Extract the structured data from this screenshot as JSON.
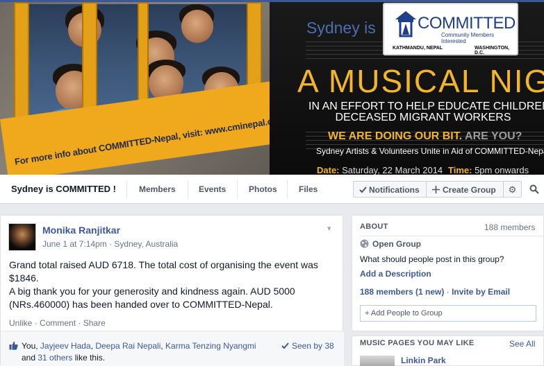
{
  "cover": {
    "banner_text": "For more info about COMMITTED-Nepal, visit: www.cminepal.org",
    "sydney_is": "Sydney is",
    "logo_word": "COMMITTED",
    "logo_sub": "Community Members Interested",
    "logo_place_left": "KATHMANDU, NEPAL",
    "logo_place_right": "WASHINGTON, D.C.",
    "headline": "A MUSICAL NIGHT",
    "subline1": "IN AN EFFORT TO HELP EDUCATE CHILDREN OF",
    "subline2": "DECEASED MIGRANT WORKERS",
    "doing_a": "WE ARE DOING OUR BIT.",
    "doing_b": "ARE YOU?",
    "artists": "Sydney Artists & Volunteers Unite in Aid of COMMITTED-Nepal",
    "date_label": "Date:",
    "date_value": "Saturday, 22 March 2014",
    "time_label": "Time:",
    "time_value": "5pm onwards"
  },
  "nav": {
    "group_name": "Sydney is COMMITTED !",
    "tabs": [
      "Members",
      "Events",
      "Photos",
      "Files"
    ],
    "notifications": "Notifications",
    "create_group": "Create Group"
  },
  "post": {
    "author": "Monika Ranjitkar",
    "meta": "June 1 at 7:14pm · Sydney, Australia",
    "paragraph1": "Grand total raised AUD 6718. The total cost of organising the event was $1846.",
    "paragraph2": "A big thank you for your generosity and kindness again. AUD 5000 (NRs.460000) has been handed over to COMMITTED-Nepal.",
    "actions": [
      "Unlike",
      "Comment",
      "Share"
    ],
    "likes_prefix": "You, ",
    "likers": [
      "Jayjeev Hada",
      "Deepa Rai Nepali",
      "Karma Tenzing Nyangmi"
    ],
    "likes_and": "and ",
    "others": "31 others",
    "likes_suffix": " like this.",
    "seen_by": "Seen by 38"
  },
  "about": {
    "heading": "ABOUT",
    "member_count": "188 members",
    "privacy": "Open Group",
    "question": "What should people post in this group?",
    "add_description": "Add a Description",
    "members_link": "188 members (1 new)",
    "invite": "Invite by Email",
    "add_people_placeholder": "+ Add People to Group"
  },
  "music": {
    "heading": "MUSIC PAGES YOU MAY LIKE",
    "see_all": "See All",
    "first_page": "Linkin Park"
  }
}
